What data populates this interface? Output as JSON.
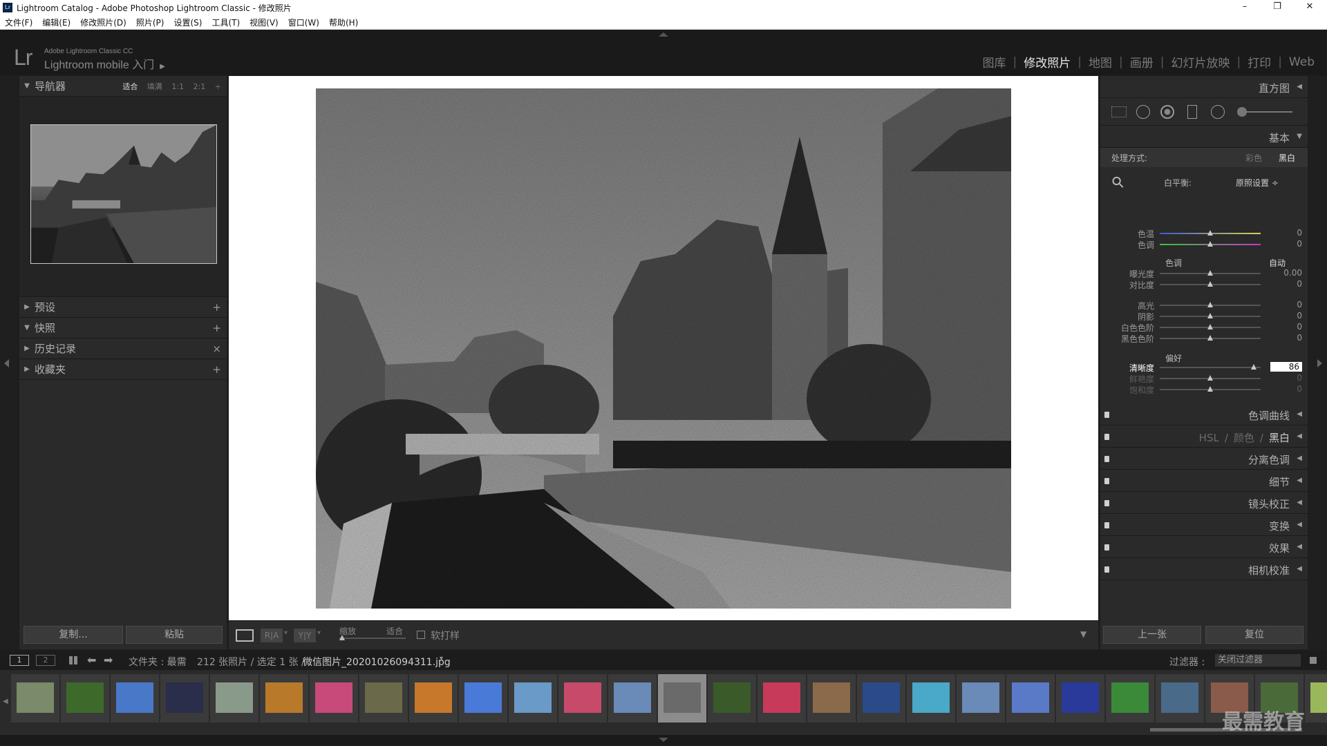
{
  "window": {
    "title": "Lightroom Catalog - Adobe Photoshop Lightroom Classic - 修改照片",
    "icon_text": "Lr",
    "controls": [
      "–",
      "❐",
      "✕"
    ]
  },
  "menu": [
    "文件(F)",
    "编辑(E)",
    "修改照片(D)",
    "照片(P)",
    "设置(S)",
    "工具(T)",
    "视图(V)",
    "窗口(W)",
    "帮助(H)"
  ],
  "identity": {
    "logo": "Lr",
    "product": "Adobe Lightroom Classic CC",
    "mobile_label": "Lightroom mobile 入门",
    "mobile_arrow": "▶"
  },
  "modules": [
    {
      "label": "图库",
      "active": false
    },
    {
      "label": "修改照片",
      "active": true
    },
    {
      "label": "地图",
      "active": false
    },
    {
      "label": "画册",
      "active": false
    },
    {
      "label": "幻灯片放映",
      "active": false
    },
    {
      "label": "打印",
      "active": false
    },
    {
      "label": "Web",
      "active": false
    }
  ],
  "module_separator": "|",
  "left_panel": {
    "navigator": {
      "title": "导航器",
      "zooms": [
        "适合",
        "填满",
        "1:1",
        "2:1"
      ],
      "zoom_arrow": "÷",
      "active_zoom": "适合"
    },
    "sections": [
      {
        "title": "预设",
        "action": "+",
        "open": false
      },
      {
        "title": "快照",
        "action": "+",
        "open": true
      },
      {
        "title": "历史记录",
        "action": "×",
        "open": false
      },
      {
        "title": "收藏夹",
        "action": "+",
        "open": false
      }
    ],
    "copy_button": "复制...",
    "paste_button": "粘贴"
  },
  "toolbar": {
    "zoom_label": "缩放",
    "zoom_value": "适合",
    "softproof_label": "软打样",
    "ra_label": "R|A",
    "yy_label": "Y|Y"
  },
  "right_panel": {
    "histogram_title": "直方图",
    "basic_title": "基本",
    "treatment_label": "处理方式:",
    "treatment_color": "彩色",
    "treatment_bw": "黑白",
    "wb_label": "白平衡:",
    "wb_value": "原照设置 ÷",
    "tone_label": "色调",
    "auto_label": "自动",
    "presence_label": "偏好",
    "sliders": [
      {
        "key": "temp",
        "name": "色温",
        "value": "0",
        "pos": 0.5
      },
      {
        "key": "tint",
        "name": "色调",
        "value": "0",
        "pos": 0.5
      },
      {
        "key": "exposure",
        "name": "曝光度",
        "value": "0.00",
        "pos": 0.5
      },
      {
        "key": "contrast",
        "name": "对比度",
        "value": "0",
        "pos": 0.5
      },
      {
        "key": "highlights",
        "name": "高光",
        "value": "0",
        "pos": 0.5
      },
      {
        "key": "shadows",
        "name": "阴影",
        "value": "0",
        "pos": 0.5
      },
      {
        "key": "whites",
        "name": "白色色阶",
        "value": "0",
        "pos": 0.5
      },
      {
        "key": "blacks",
        "name": "黑色色阶",
        "value": "0",
        "pos": 0.5
      },
      {
        "key": "clarity",
        "name": "清晰度",
        "value": "86",
        "pos": 0.93
      },
      {
        "key": "vibrance",
        "name": "鲜艳度",
        "value": "0",
        "pos": 0.5
      },
      {
        "key": "saturation",
        "name": "饱和度",
        "value": "0",
        "pos": 0.5
      }
    ],
    "collapsed_panels": [
      {
        "key": "tone-curve",
        "label": "色调曲线"
      },
      {
        "key": "hsl",
        "label": "HSL / 颜色 / 黑白"
      },
      {
        "key": "split-toning",
        "label": "分离色调"
      },
      {
        "key": "detail",
        "label": "细节"
      },
      {
        "key": "lens",
        "label": "镜头校正"
      },
      {
        "key": "transform",
        "label": "变换"
      },
      {
        "key": "effects",
        "label": "效果"
      },
      {
        "key": "calibration",
        "label": "相机校准"
      }
    ],
    "hsl_parts": [
      "HSL",
      "/",
      "颜色",
      "/",
      "黑白"
    ],
    "prev_button": "上一张",
    "reset_button": "复位"
  },
  "filmstrip": {
    "page1": "1",
    "page2": "2",
    "source": "文件夹 : 最需",
    "count": "212 张照片 / 选定 1 张 /",
    "filename": "微信图片_20201026094311.jpg",
    "filter_label": "过滤器 :",
    "filter_value": "关闭过滤器",
    "thumbs": [
      "#7a8a6a",
      "#3d6a2a",
      "#4a78c8",
      "#2a2e4a",
      "#8a9a8a",
      "#b87a2a",
      "#c84a7a",
      "#6a6a4a",
      "#c8782a",
      "#4a7ad8",
      "#6a9ac8",
      "#c84a6a",
      "#6a8ab8",
      "#6a6a6a",
      "#3a5a2a",
      "#c83a5a",
      "#8a6a4a",
      "#2a4a8a",
      "#4aa8c8",
      "#6a8ab8",
      "#5a7ac8",
      "#2a3a9a",
      "#3a8a3a",
      "#4a6a8a",
      "#8a5a4a",
      "#4a6a3a",
      "#9ab85a"
    ],
    "selected_index": 13
  },
  "watermark": "最需教育",
  "colors": {
    "accent": "#e6e6e6",
    "panel": "#2a2a2a",
    "background": "#1e1e1e"
  }
}
